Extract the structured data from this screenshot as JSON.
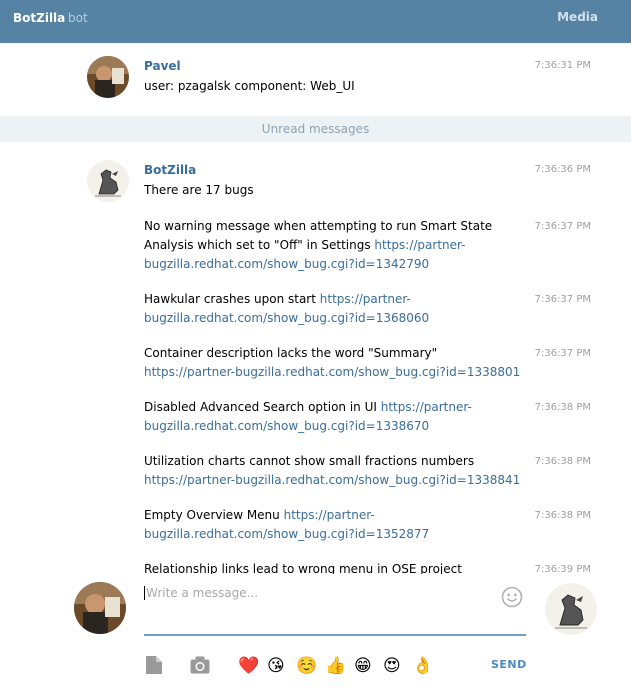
{
  "header": {
    "title": "BotZilla",
    "subtitle": "bot",
    "media_label": "Media"
  },
  "first_message": {
    "author": "Pavel",
    "time": "7:36:31 PM",
    "text": "user: pzagalsk component: Web_UI"
  },
  "unread_label": "Unread messages",
  "bot": {
    "author": "BotZilla",
    "messages": [
      {
        "time": "7:36:36 PM",
        "text": "There are 17  bugs",
        "link": ""
      },
      {
        "time": "7:36:37 PM",
        "text": "No warning message when attempting to run Smart State Analysis which set to \"Off\" in Settings ",
        "link": "https://partner-bugzilla.redhat.com/show_bug.cgi?id=1342790"
      },
      {
        "time": "7:36:37 PM",
        "text": "Hawkular crashes upon start ",
        "link": "https://partner-bugzilla.redhat.com/show_bug.cgi?id=1368060"
      },
      {
        "time": "7:36:37 PM",
        "text": "Container description lacks the word \"Summary\" ",
        "link": "https://partner-bugzilla.redhat.com/show_bug.cgi?id=1338801"
      },
      {
        "time": "7:36:38 PM",
        "text": "Disabled Advanced Search option in UI ",
        "link": "https://partner-bugzilla.redhat.com/show_bug.cgi?id=1338670"
      },
      {
        "time": "7:36:38 PM",
        "text": "Utilization charts cannot show small fractions numbers ",
        "link": "https://partner-bugzilla.redhat.com/show_bug.cgi?id=1338841"
      },
      {
        "time": "7:36:38 PM",
        "text": "Empty Overview Menu ",
        "link": "https://partner-bugzilla.redhat.com/show_bug.cgi?id=1352877"
      },
      {
        "time": "7:36:39 PM",
        "text": "Relationship links lead to wrong menu in OSE project",
        "link": ""
      }
    ]
  },
  "compose": {
    "placeholder": "Write a message...",
    "send_label": "SEND",
    "emojis": [
      "❤️",
      "😘",
      "☺️",
      "👍",
      "😁",
      "😍",
      "👌"
    ]
  }
}
